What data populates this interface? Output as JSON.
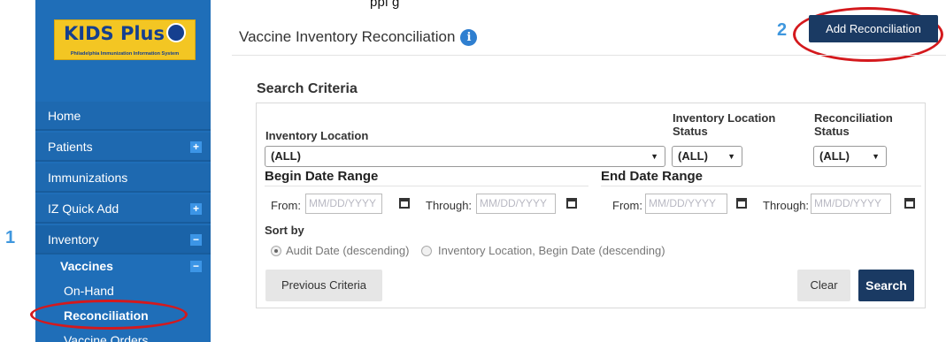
{
  "top_fragment": "ppi  g",
  "app": {
    "logo_text": "KIDS Plus",
    "logo_subtitle": "Philadelphia Immunization Information System"
  },
  "sidebar": {
    "items": [
      {
        "label": "Home"
      },
      {
        "label": "Patients",
        "expander": "+"
      },
      {
        "label": "Immunizations"
      },
      {
        "label": "IZ Quick Add",
        "expander": "+"
      },
      {
        "label": "Inventory",
        "expander": "−"
      }
    ],
    "vaccines": {
      "label": "Vaccines",
      "expander": "−"
    },
    "sub_items": [
      {
        "label": "On-Hand"
      },
      {
        "label": "Reconciliation"
      },
      {
        "label": "Vaccine Orders"
      }
    ]
  },
  "callouts": {
    "one": "1",
    "two": "2"
  },
  "header": {
    "title": "Vaccine Inventory Reconciliation",
    "info_icon": "i",
    "add_button": "Add Reconciliation"
  },
  "search": {
    "section_title": "Search Criteria",
    "inventory_location": {
      "label": "Inventory Location",
      "value": "(ALL)"
    },
    "inventory_location_status": {
      "label_line1": "Inventory Location",
      "label_line2": "Status",
      "value": "(ALL)"
    },
    "reconciliation_status": {
      "label_line1": "Reconciliation",
      "label_line2": "Status",
      "value": "(ALL)"
    },
    "begin_date_range": {
      "title": "Begin Date Range",
      "from_label": "From:",
      "from_placeholder": "MM/DD/YYYY",
      "through_label": "Through:",
      "through_placeholder": "MM/DD/YYYY"
    },
    "end_date_range": {
      "title": "End Date Range",
      "from_label": "From:",
      "from_placeholder": "MM/DD/YYYY",
      "through_label": "Through:",
      "through_placeholder": "MM/DD/YYYY"
    },
    "sort_by": {
      "label": "Sort by",
      "options": [
        {
          "label": "Audit Date (descending)",
          "selected": true
        },
        {
          "label": "Inventory Location, Begin Date (descending)",
          "selected": false
        }
      ]
    },
    "buttons": {
      "previous": "Previous Criteria",
      "clear": "Clear",
      "search": "Search"
    }
  },
  "colors": {
    "sidebar": "#1f6eb8",
    "primary_button": "#1a3a63",
    "callout": "#3f97de",
    "highlight_ellipse": "#d4191d"
  }
}
